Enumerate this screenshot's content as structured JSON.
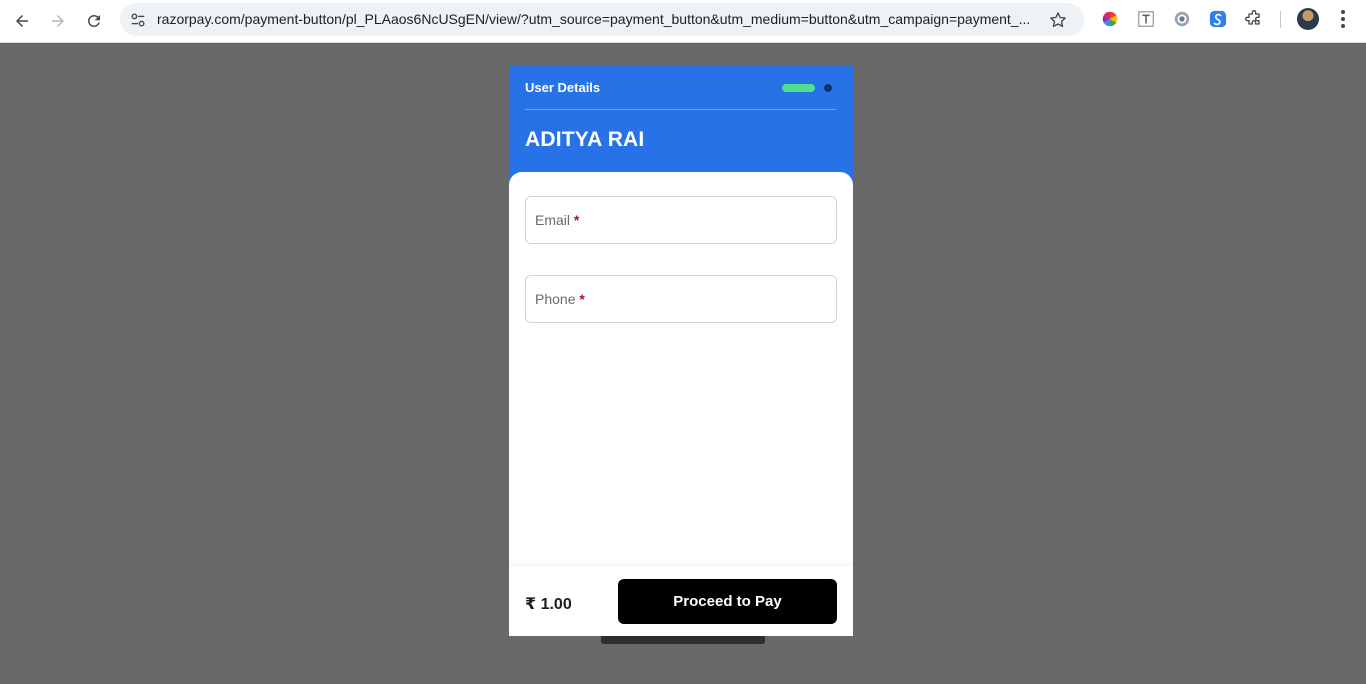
{
  "browser": {
    "url": "razorpay.com/payment-button/pl_PLAaos6NcUSgEN/view/?utm_source=payment_button&utm_medium=button&utm_campaign=payment_...",
    "back_icon": "arrow-left-icon",
    "forward_icon": "arrow-right-icon",
    "reload_icon": "reload-icon",
    "bookmark_icon": "star-icon",
    "extensions": [
      "color-wheel-extension-icon",
      "text-t-extension-icon",
      "circle-extension-icon",
      "s-swirl-extension-icon",
      "puzzle-piece-icon"
    ],
    "menu_icon": "kebab-menu-icon"
  },
  "payment": {
    "step_label": "User Details",
    "merchant_name": "ADITYA RAI",
    "fields": {
      "email": {
        "label": "Email",
        "required_mark": "*"
      },
      "phone": {
        "label": "Phone",
        "required_mark": "*"
      }
    },
    "amount": "₹ 1.00",
    "pay_button_label": "Proceed to Pay"
  },
  "colors": {
    "header_blue": "#2872e8",
    "step_active_green": "#4ee08f",
    "step_inactive": "#13306e",
    "pay_button": "#000000",
    "required_mark": "#a0152b",
    "backdrop": "#686868"
  }
}
